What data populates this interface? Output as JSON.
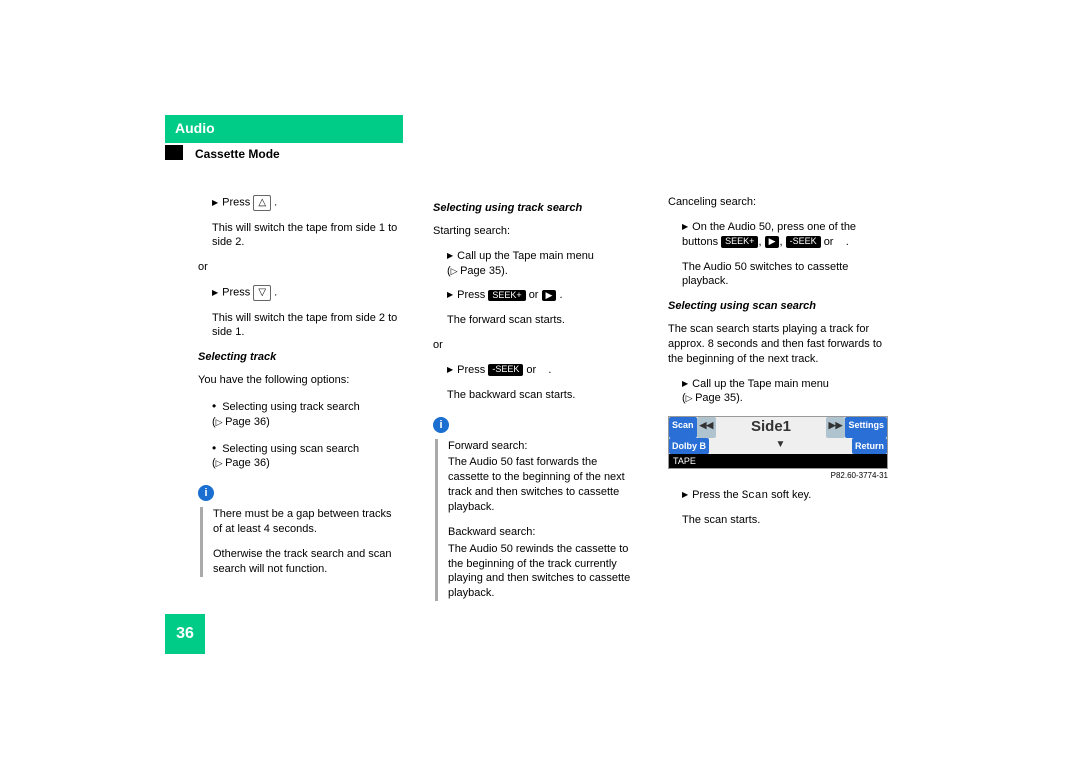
{
  "header": {
    "section": "Audio",
    "subtitle": "Cassette Mode"
  },
  "page_number": "36",
  "col1": {
    "press": "Press",
    "switch12": "This will switch the tape from side 1 to side 2.",
    "or": "or",
    "switch21": "This will switch the tape from side 2 to side 1.",
    "selTrack": "Selecting track",
    "opts": "You have the following options:",
    "li1a": "Selecting using track search",
    "li1b": "Page 36)",
    "li2a": "Selecting using scan search",
    "li2b": "Page 36)",
    "note1": "There must be a gap between tracks of at least 4 seconds.",
    "note2": "Otherwise the track search and scan search will not function."
  },
  "col2": {
    "title": "Selecting using track search",
    "start": "Starting search:",
    "call": "Call up the Tape main menu",
    "pg35": "Page 35).",
    "pressSeekF": "Press",
    "seekp": "SEEK+",
    "or": "or",
    "fscan": "The forward scan starts.",
    "or2": "or",
    "pressSeekB": "Press",
    "seekm": "-SEEK",
    "bscan": "The backward scan starts.",
    "fwdTitle": "Forward search:",
    "fwd": "The Audio 50 fast forwards the cassette to the beginning of the next track and then switches to cassette playback.",
    "bwdTitle": "Backward search:",
    "bwd": "The Audio 50 rewinds the cassette to the beginning of the track currently playing and then switches to cassette playback."
  },
  "col3": {
    "cancel": "Canceling search:",
    "onAudio": "On the Audio 50, press one of the buttons",
    "seekp": "SEEK+",
    "seekm": "-SEEK",
    "or": "or",
    "switchBack": "The Audio 50 switches to cassette playback.",
    "scanTitle": "Selecting using scan search",
    "scanDesc": "The scan search starts playing a track for approx. 8 seconds and then fast forwards to the beginning of the next track.",
    "call": "Call up the Tape main menu",
    "pg35": "Page 35).",
    "display": {
      "scan": "Scan",
      "settings": "Settings",
      "side": "Side1",
      "dolby": "Dolby B",
      "return": "Return",
      "tape": "TAPE",
      "code": "P82.60-3774-31"
    },
    "pressScan1": "Press the",
    "scanKey": "Scan",
    "pressScan2": "soft key.",
    "scanStarts": "The scan starts."
  }
}
